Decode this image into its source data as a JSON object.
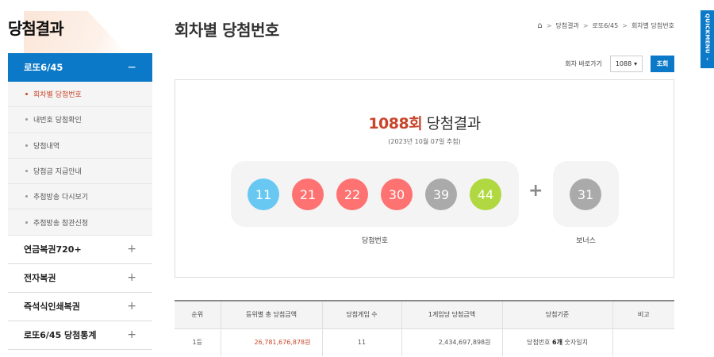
{
  "sidebar": {
    "title": "당첨결과",
    "active_menu": {
      "label": "로또6/45",
      "symbol": "−"
    },
    "sub_items": [
      {
        "label": "회차별 당첨번호",
        "active": true
      },
      {
        "label": "내번호 당첨확인",
        "active": false
      },
      {
        "label": "당첨내역",
        "active": false
      },
      {
        "label": "당첨금 지급안내",
        "active": false
      },
      {
        "label": "추첨방송 다시보기",
        "active": false
      },
      {
        "label": "추첨방송 참관신청",
        "active": false
      }
    ],
    "menus": [
      {
        "label": "연금복권720+",
        "symbol": "+"
      },
      {
        "label": "전자복권",
        "symbol": "+"
      },
      {
        "label": "즉석식인쇄복권",
        "symbol": "+"
      },
      {
        "label": "로또6/45 당첨통계",
        "symbol": "+"
      }
    ]
  },
  "header": {
    "title": "회차별 당첨번호",
    "breadcrumb": [
      "당첨결과",
      "로또6/45",
      "회차별 당첨번호"
    ],
    "home_icon": "home-icon"
  },
  "jump": {
    "label": "회차 바로가기",
    "selected": "1088",
    "button": "조회"
  },
  "result": {
    "round": "1088회",
    "title_suffix": "당첨결과",
    "date": "(2023년 10월 07일 추첨)",
    "numbers": [
      {
        "value": "11",
        "color": "#69c8f2"
      },
      {
        "value": "21",
        "color": "#ff7272"
      },
      {
        "value": "22",
        "color": "#ff7272"
      },
      {
        "value": "30",
        "color": "#ff7272"
      },
      {
        "value": "39",
        "color": "#aaaaaa"
      },
      {
        "value": "44",
        "color": "#b0d840"
      }
    ],
    "plus": "+",
    "bonus": {
      "value": "31",
      "color": "#aaaaaa"
    },
    "numbers_caption": "당첨번호",
    "bonus_caption": "보너스"
  },
  "table": {
    "headers": [
      "순위",
      "등위별 총 당첨금액",
      "당첨게임 수",
      "1게임당 당첨금액",
      "당첨기준",
      "비고"
    ],
    "rows": [
      {
        "rank": "1등",
        "total": "26,781,676,878원",
        "games": "11",
        "per_game": "2,434,697,898원",
        "criteria_pre": "당첨번호 ",
        "criteria_bold": "6개",
        "criteria_post": " 숫자일치",
        "note": ""
      }
    ]
  },
  "quick_menu": {
    "label": "QUICKMENU",
    "arrow": "‹"
  }
}
